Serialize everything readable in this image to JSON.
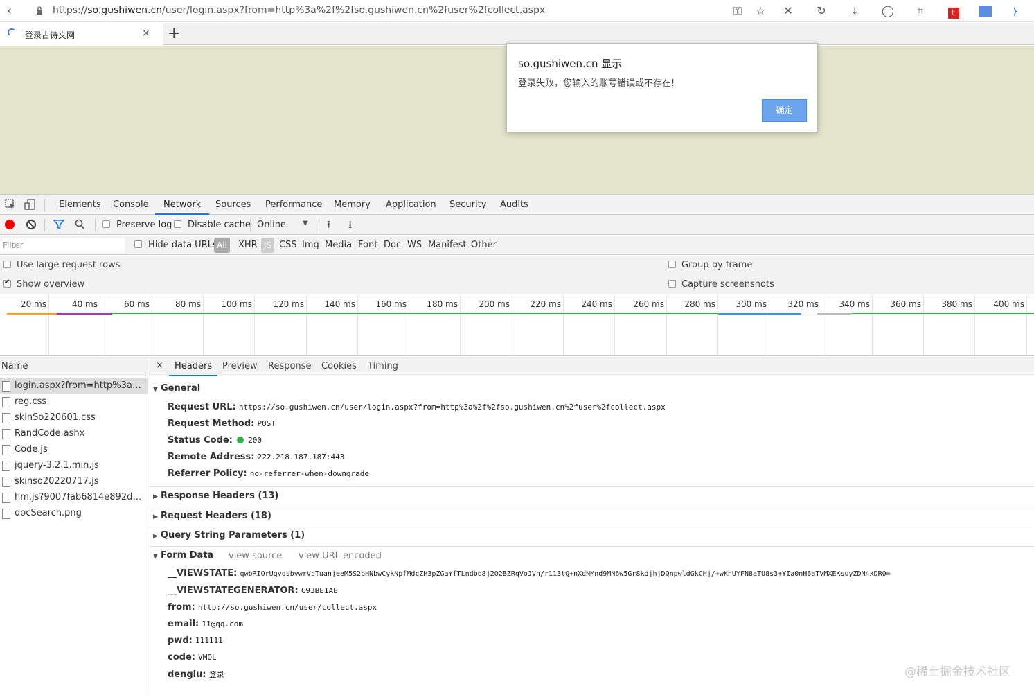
{
  "browser": {
    "url_prefix": "https://",
    "url_host": "so.gushiwen.cn",
    "url_path": "/user/login.aspx?from=http%3a%2f%2fso.gushiwen.cn%2fuser%2fcollect.aspx",
    "tab_title": "登录古诗文网",
    "tab_close": "×",
    "new_tab": "+",
    "toolbar_icons": [
      "key-icon",
      "star-icon",
      "close-icon",
      "reload-icon",
      "download-icon",
      "account-icon",
      "crop-icon",
      "extension-icon",
      "apps-icon",
      "speaker-icon"
    ]
  },
  "alert": {
    "title": "so.gushiwen.cn 显示",
    "message": "登录失败，您输入的账号错误或不存在!",
    "ok_label": "确定"
  },
  "devtools": {
    "tabs": [
      "Elements",
      "Console",
      "Network",
      "Sources",
      "Performance",
      "Memory",
      "Application",
      "Security",
      "Audits"
    ],
    "active_tab": "Network"
  },
  "network_toolbar": {
    "preserve_log": "Preserve log",
    "disable_cache": "Disable cache",
    "throttle": "Online"
  },
  "filter": {
    "placeholder": "Filter",
    "hide_data_urls": "Hide data URLs",
    "types": [
      "All",
      "XHR",
      "JS",
      "CSS",
      "Img",
      "Media",
      "Font",
      "Doc",
      "WS",
      "Manifest",
      "Other"
    ]
  },
  "options": {
    "large_rows": "Use large request rows",
    "show_overview": "Show overview",
    "group_by_frame": "Group by frame",
    "capture_screenshots": "Capture screenshots"
  },
  "timeline": {
    "ticks": [
      "20 ms",
      "40 ms",
      "60 ms",
      "80 ms",
      "100 ms",
      "120 ms",
      "140 ms",
      "160 ms",
      "180 ms",
      "200 ms",
      "220 ms",
      "240 ms",
      "260 ms",
      "280 ms",
      "300 ms",
      "320 ms",
      "340 ms",
      "360 ms",
      "380 ms",
      "400 ms"
    ]
  },
  "requests": {
    "header": "Name",
    "items": [
      "login.aspx?from=http%3a%2f...",
      "reg.css",
      "skinSo220601.css",
      "RandCode.ashx",
      "Code.js",
      "jquery-3.2.1.min.js",
      "skinso20220717.js",
      "hm.js?9007fab6814e892d3020...",
      "docSearch.png"
    ]
  },
  "detail": {
    "close": "×",
    "tabs": [
      "Headers",
      "Preview",
      "Response",
      "Cookies",
      "Timing"
    ],
    "active_tab": "Headers",
    "general_title": "General",
    "general": [
      {
        "k": "Request URL:",
        "v": "https://so.gushiwen.cn/user/login.aspx?from=http%3a%2f%2fso.gushiwen.cn%2fuser%2fcollect.aspx"
      },
      {
        "k": "Request Method:",
        "v": "POST"
      },
      {
        "k": "Status Code:",
        "v": "200"
      },
      {
        "k": "Remote Address:",
        "v": "222.218.187.187:443"
      },
      {
        "k": "Referrer Policy:",
        "v": "no-referrer-when-downgrade"
      }
    ],
    "response_headers": "Response Headers (13)",
    "request_headers": "Request Headers (18)",
    "query_params": "Query String Parameters (1)",
    "form_data_title": "Form Data",
    "view_source": "view source",
    "view_url_encoded": "view URL encoded",
    "form_data": [
      {
        "k": "__VIEWSTATE:",
        "v": "qwbRIOrUgvgsbvwrVcTuanjeeM5S2bHNbwCykNpfMdcZH3pZGaYfTLndbo8j2O2BZRqVoJVn/r113tQ+nXdNMnd9MN6w5Gr8kdjhjDQnpwldGkCHj/+wKhUYFN8aTU8s3+YIa0nH6aTVMXEKsuyZDN4xDR0="
      },
      {
        "k": "__VIEWSTATEGENERATOR:",
        "v": "C93BE1AE"
      },
      {
        "k": "from:",
        "v": "http://so.gushiwen.cn/user/collect.aspx"
      },
      {
        "k": "email:",
        "v": "11@qq.com"
      },
      {
        "k": "pwd:",
        "v": "111111"
      },
      {
        "k": "code:",
        "v": "VMOL"
      },
      {
        "k": "denglu:",
        "v": "登录"
      }
    ]
  },
  "watermark": "@稀土掘金技术社区",
  "colors": {
    "page_bg": "#e4e3cc",
    "accent": "#1a73e8",
    "record": "#ee0000",
    "ok_button": "#6ea4ee",
    "status_ok": "#2db24a"
  }
}
